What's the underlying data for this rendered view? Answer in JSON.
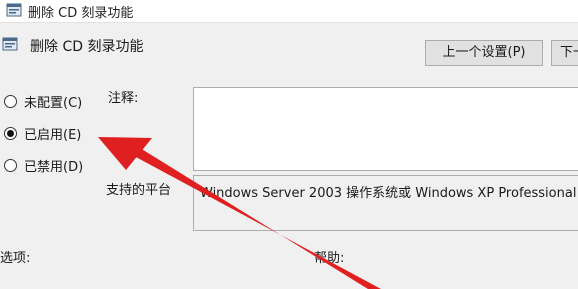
{
  "window": {
    "title": "删除 CD 刻录功能",
    "icon": "policy-setting-icon"
  },
  "policy": {
    "name": "删除 CD 刻录功能",
    "icon": "policy-setting-icon"
  },
  "nav": {
    "prev_label": "上一个设置(P)",
    "next_label": "下一"
  },
  "state": {
    "options": [
      {
        "label": "未配置(C)",
        "checked": false
      },
      {
        "label": "已启用(E)",
        "checked": true
      },
      {
        "label": "已禁用(D)",
        "checked": false
      }
    ]
  },
  "fields": {
    "comment_label": "注释:",
    "comment_value": "",
    "supported_label": "支持的平台",
    "supported_value": "Windows Server 2003 操作系统或 Windows XP Professional"
  },
  "panels": {
    "options_label": "选项:",
    "help_label": "帮助:"
  },
  "annotation": {
    "icon": "red-arrow-icon",
    "color": "#e02020"
  }
}
